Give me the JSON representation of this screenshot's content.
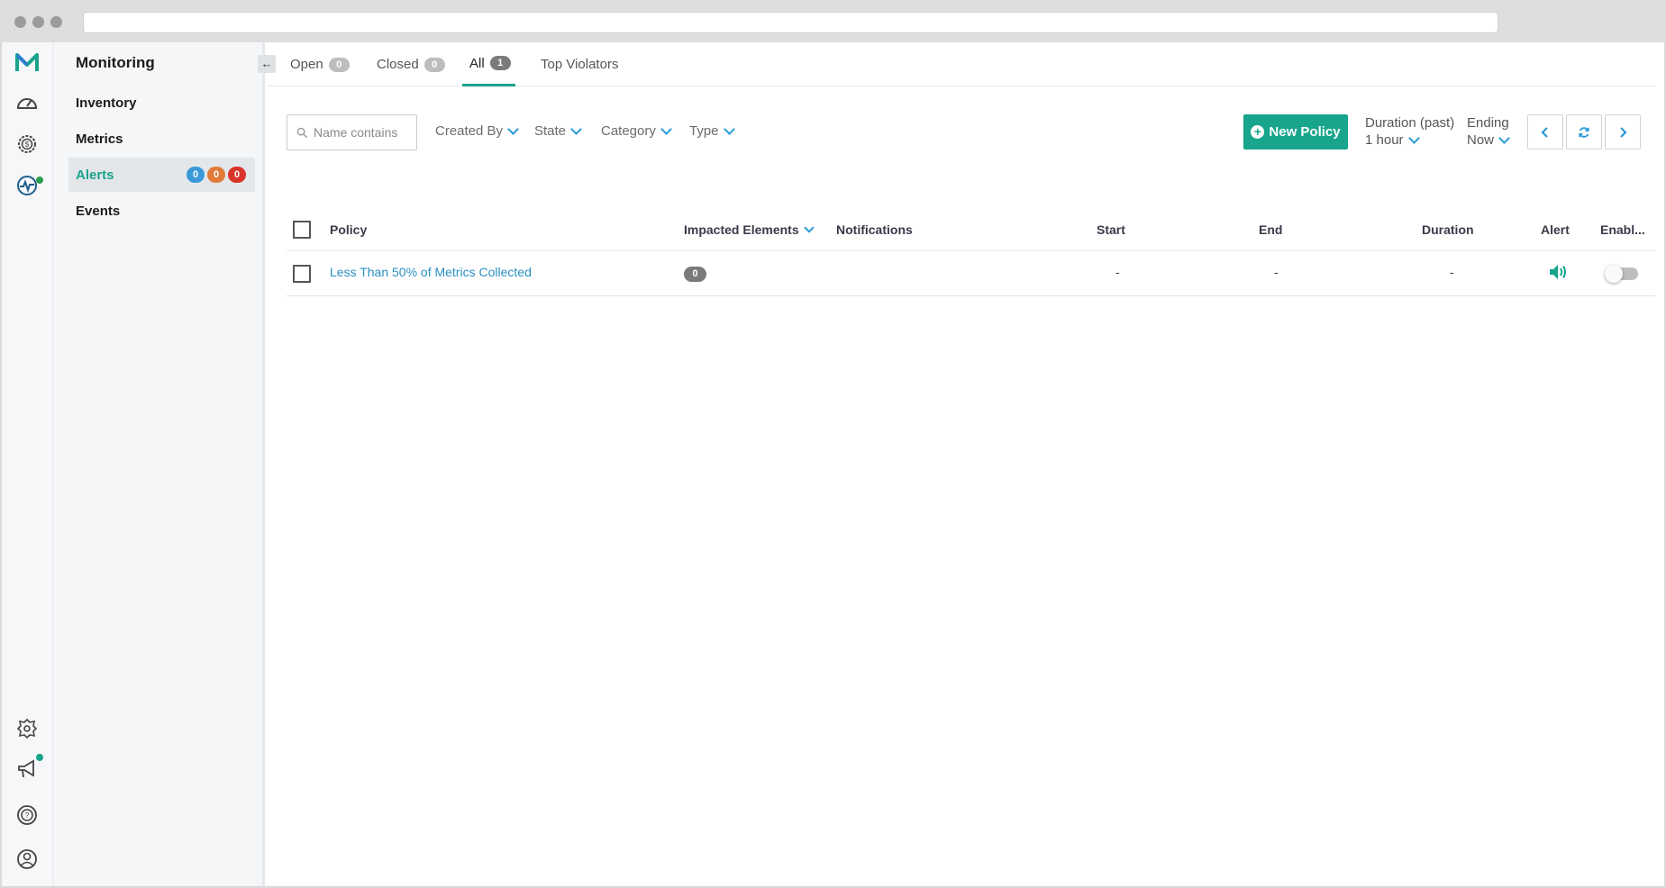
{
  "colors": {
    "accent": "#17a58c",
    "link": "#2a8fc2",
    "pill_blue": "#3a9ad9",
    "pill_orange": "#e07b39",
    "pill_red": "#d9342b",
    "notification_dot": "#1aa38b"
  },
  "rail": {
    "icons": [
      "logo-icon",
      "dashboard-icon",
      "cost-gear-icon",
      "monitoring-icon",
      "integrations-icon",
      "announcements-icon",
      "help-icon",
      "user-icon"
    ]
  },
  "nav": {
    "title": "Monitoring",
    "items": [
      {
        "label": "Inventory"
      },
      {
        "label": "Metrics"
      },
      {
        "label": "Alerts",
        "badges": [
          "0",
          "0",
          "0"
        ]
      },
      {
        "label": "Events"
      }
    ],
    "collapse_symbol": "←"
  },
  "tabs": [
    {
      "label": "Open",
      "count": "0"
    },
    {
      "label": "Closed",
      "count": "0"
    },
    {
      "label": "All",
      "count": "1"
    },
    {
      "label": "Top Violators"
    }
  ],
  "toolbar": {
    "search_placeholder": "Name contains",
    "filters": [
      "Created By",
      "State",
      "Category",
      "Type"
    ],
    "new_policy_label": "New Policy",
    "duration_label": "Duration (past)",
    "duration_value": "1 hour",
    "ending_label": "Ending",
    "ending_value": "Now"
  },
  "table": {
    "headers": [
      "Policy",
      "Impacted Elements",
      "Notifications",
      "Start",
      "End",
      "Duration",
      "Alert",
      "Enabl..."
    ],
    "rows": [
      {
        "policy": "Less Than 50% of Metrics Collected",
        "impacted_elements": "0",
        "notifications": "",
        "start": "-",
        "end": "-",
        "duration": "-",
        "alert_icon": "speaker-icon",
        "enabled": false
      }
    ]
  }
}
